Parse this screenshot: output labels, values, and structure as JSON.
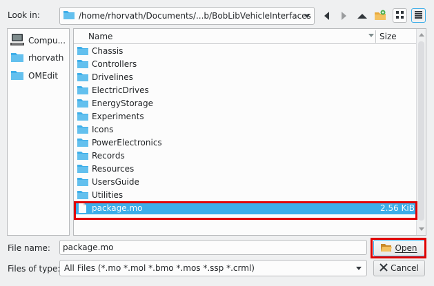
{
  "lookin": {
    "label": "Look in:",
    "path": "/home/rhorvath/Documents/...b/BobLibVehicleInterfaces"
  },
  "sidebar": {
    "items": [
      {
        "label": "Compu...",
        "icon": "computer-icon"
      },
      {
        "label": "rhorvath",
        "icon": "folder-icon"
      },
      {
        "label": "OMEdit",
        "icon": "folder-icon"
      }
    ]
  },
  "filelist": {
    "columns": {
      "name": "Name",
      "size": "Size"
    },
    "folders": [
      "Chassis",
      "Controllers",
      "Drivelines",
      "ElectricDrives",
      "EnergyStorage",
      "Experiments",
      "Icons",
      "PowerElectronics",
      "Records",
      "Resources",
      "UsersGuide",
      "Utilities"
    ],
    "selected_file": {
      "name": "package.mo",
      "size": "2.56 KiB"
    }
  },
  "bottom": {
    "filename_label": "File name:",
    "filename_value": "package.mo",
    "type_label": "Files of type:",
    "type_value": "All Files (*.mo *.mol *.bmo *.mos *.ssp *.crml)",
    "open_label": "Open",
    "cancel_label": "Cancel"
  },
  "colors": {
    "accent": "#3daee9",
    "folder": "#3daee9",
    "highlight": "#e00000"
  }
}
